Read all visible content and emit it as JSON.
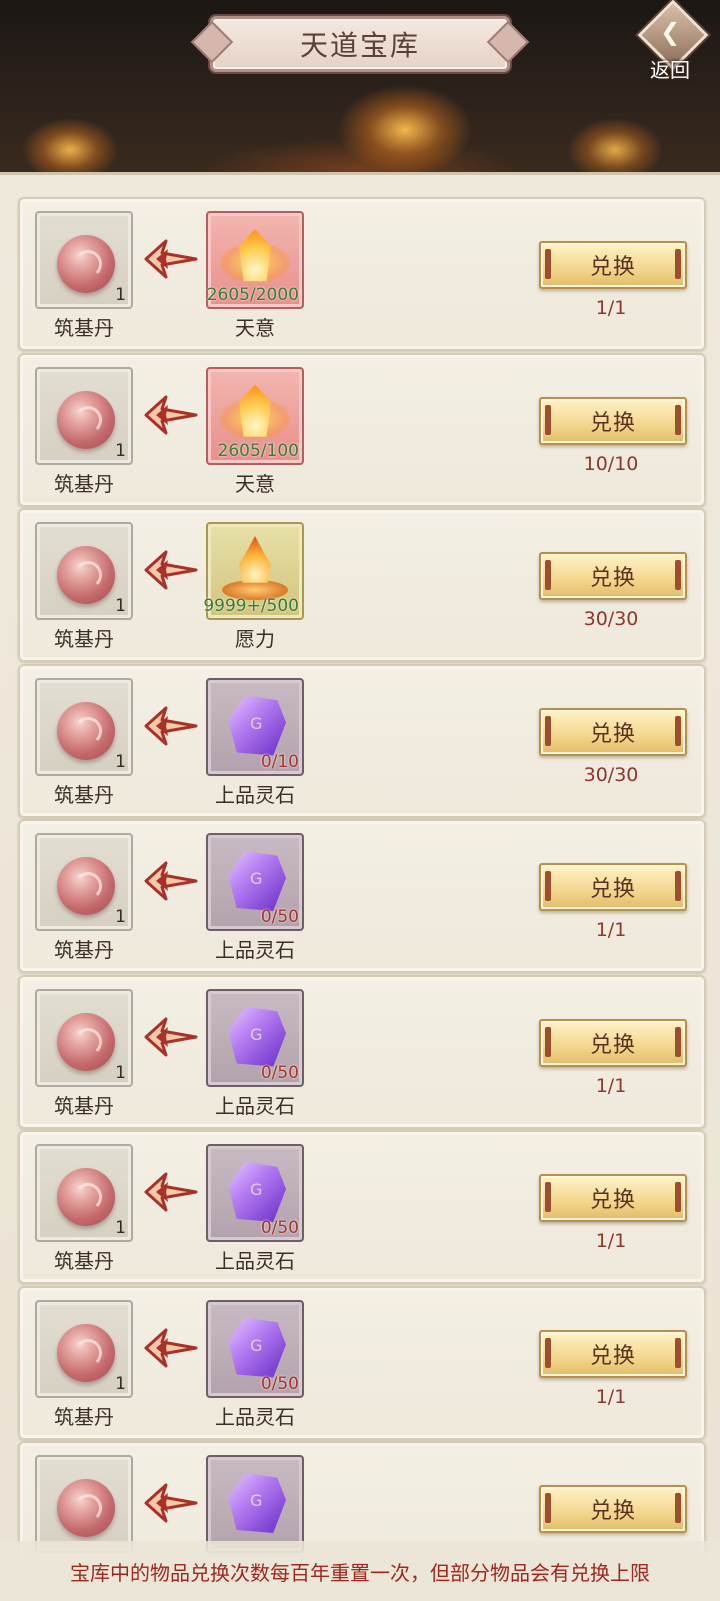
{
  "header": {
    "title": "天道宝库",
    "back_label": "返回"
  },
  "rows": [
    {
      "reward_name": "筑基丹",
      "reward_count": "1",
      "cost_name": "天意",
      "cost_qty": "2605/2000",
      "cost_icon": "heavenly-will-crystal-icon",
      "button_label": "兑换",
      "limit": "1/1"
    },
    {
      "reward_name": "筑基丹",
      "reward_count": "1",
      "cost_name": "天意",
      "cost_qty": "2605/100",
      "cost_icon": "heavenly-will-crystal-icon",
      "button_label": "兑换",
      "limit": "10/10"
    },
    {
      "reward_name": "筑基丹",
      "reward_count": "1",
      "cost_name": "愿力",
      "cost_qty": "9999+/500",
      "cost_icon": "wish-power-flame-icon",
      "button_label": "兑换",
      "limit": "30/30"
    },
    {
      "reward_name": "筑基丹",
      "reward_count": "1",
      "cost_name": "上品灵石",
      "cost_qty": "0/10",
      "cost_icon": "spirit-stone-icon",
      "button_label": "兑换",
      "limit": "30/30"
    },
    {
      "reward_name": "筑基丹",
      "reward_count": "1",
      "cost_name": "上品灵石",
      "cost_qty": "0/50",
      "cost_icon": "spirit-stone-icon",
      "button_label": "兑换",
      "limit": "1/1"
    },
    {
      "reward_name": "筑基丹",
      "reward_count": "1",
      "cost_name": "上品灵石",
      "cost_qty": "0/50",
      "cost_icon": "spirit-stone-icon",
      "button_label": "兑换",
      "limit": "1/1"
    },
    {
      "reward_name": "筑基丹",
      "reward_count": "1",
      "cost_name": "上品灵石",
      "cost_qty": "0/50",
      "cost_icon": "spirit-stone-icon",
      "button_label": "兑换",
      "limit": "1/1"
    },
    {
      "reward_name": "筑基丹",
      "reward_count": "1",
      "cost_name": "上品灵石",
      "cost_qty": "0/50",
      "cost_icon": "spirit-stone-icon",
      "button_label": "兑换",
      "limit": "1/1"
    },
    {
      "reward_name": "",
      "reward_count": "",
      "cost_name": "",
      "cost_qty": "",
      "cost_icon": "spirit-stone-icon",
      "button_label": "兑换",
      "limit": ""
    }
  ],
  "footer": {
    "notice": "宝库中的物品兑换次数每百年重置一次，但部分物品会有兑换上限"
  },
  "colors": {
    "qty_sufficient": "#3a7a32",
    "qty_insufficient": "#a8322a",
    "notice_text": "#a0281e"
  }
}
